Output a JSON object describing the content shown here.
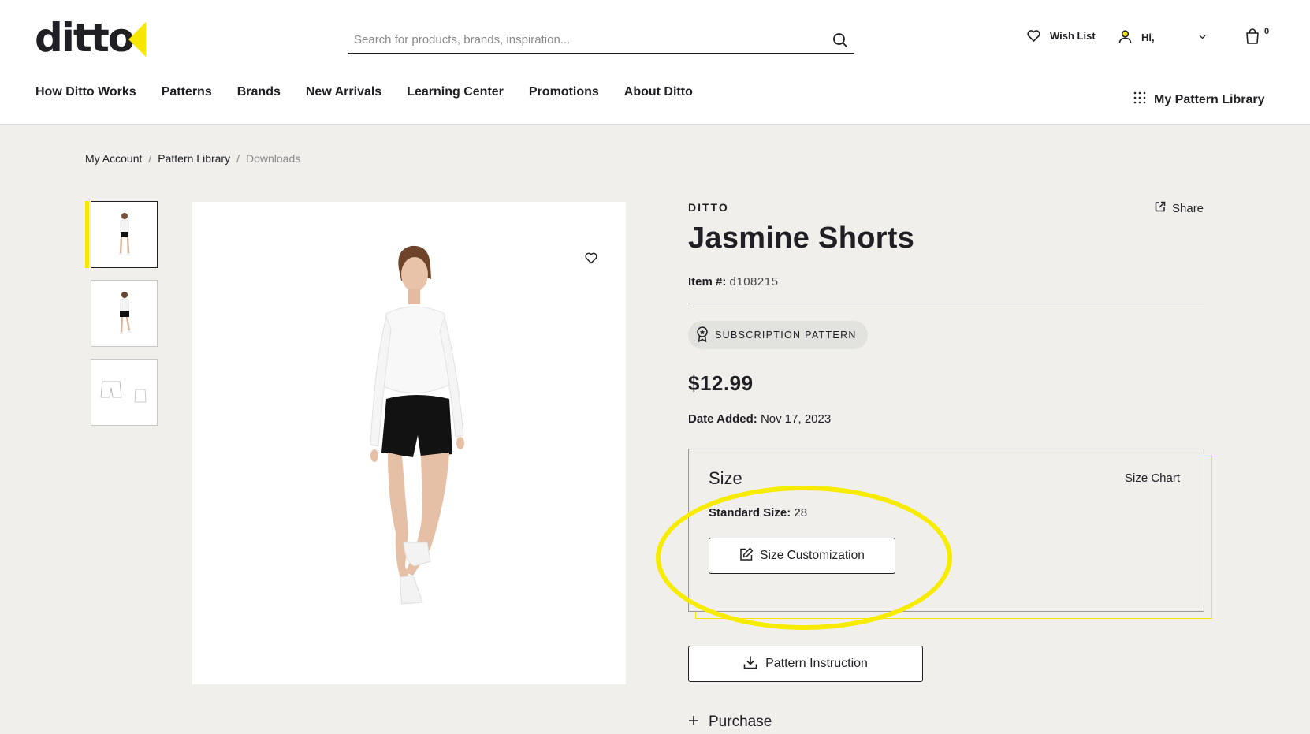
{
  "header": {
    "logo": "ditto",
    "search": {
      "placeholder": "Search for products, brands, inspiration..."
    },
    "wishlist_label": "Wish List",
    "greeting": "Hi,",
    "cart_count": "0"
  },
  "nav": {
    "items": [
      "How Ditto Works",
      "Patterns",
      "Brands",
      "New Arrivals",
      "Learning Center",
      "Promotions",
      "About Ditto"
    ],
    "my_library": "My Pattern Library"
  },
  "breadcrumb": {
    "items": [
      "My Account",
      "Pattern Library"
    ],
    "separator": "/",
    "current": "Downloads"
  },
  "product": {
    "brand": "DITTO",
    "share_label": "Share",
    "title": "Jasmine Shorts",
    "item_label": "Item #:",
    "item_number": "d108215",
    "badge": "SUBSCRIPTION PATTERN",
    "price": "$12.99",
    "date_label": "Date Added:",
    "date_value": "Nov 17, 2023",
    "size": {
      "title": "Size",
      "chart_link": "Size Chart",
      "standard_label": "Standard Size:",
      "standard_value": "28",
      "customize_button": "Size Customization"
    },
    "instruction_button": "Pattern Instruction",
    "purchase_label": "Purchase"
  },
  "colors": {
    "accent": "#f7e600",
    "text": "#1f1f24",
    "background": "#f0efec"
  }
}
